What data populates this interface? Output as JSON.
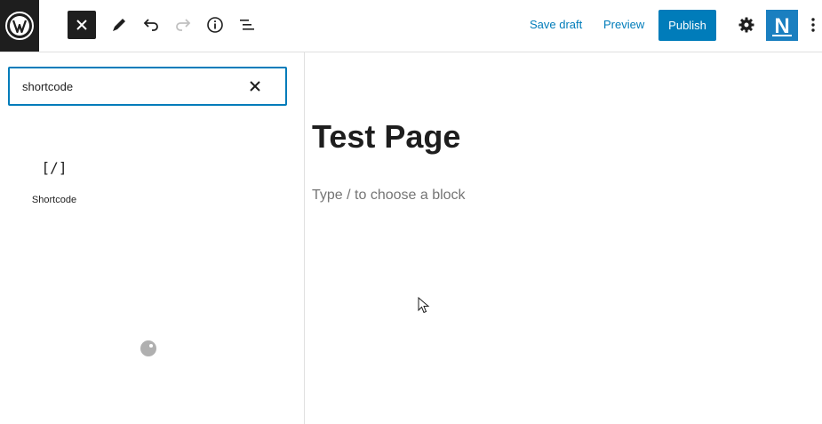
{
  "header": {
    "save_draft_label": "Save draft",
    "preview_label": "Preview",
    "publish_label": "Publish",
    "logo_letter": "N",
    "icons": {
      "wordpress": "wordpress-logo-icon",
      "close_inserter": "close-icon",
      "tools": "pencil-icon",
      "undo": "undo-icon",
      "redo": "redo-icon",
      "details": "info-icon",
      "outline": "list-view-icon",
      "settings": "gear-icon",
      "more": "vertical-ellipsis-icon"
    }
  },
  "inserter": {
    "search_value": "shortcode",
    "results": [
      {
        "icon_glyph": "[/]",
        "label": "Shortcode"
      }
    ]
  },
  "editor": {
    "title": "Test Page",
    "block_placeholder": "Type / to choose a block"
  },
  "colors": {
    "accent": "#007cba",
    "dark": "#1e1e1e",
    "placeholder": "#757575",
    "brand_logo": "#1a7fc0"
  }
}
